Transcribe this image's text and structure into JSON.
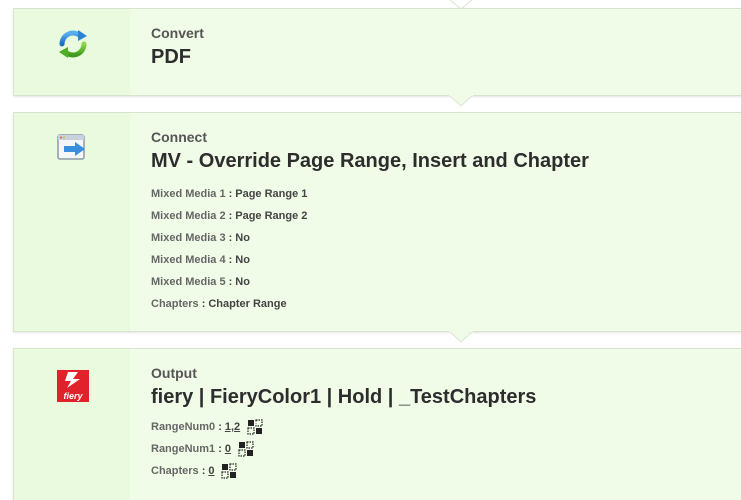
{
  "steps": [
    {
      "icon": "refresh-arrows-icon",
      "label": "Convert",
      "value": "PDF"
    },
    {
      "icon": "window-arrow-icon",
      "label": "Connect",
      "value": "MV - Override Page Range, Insert and Chapter",
      "properties": [
        {
          "key": "Mixed Media 1",
          "value": "Page Range 1"
        },
        {
          "key": "Mixed Media 2",
          "value": "Page Range 2"
        },
        {
          "key": "Mixed Media 3",
          "value": "No"
        },
        {
          "key": "Mixed Media 4",
          "value": "No"
        },
        {
          "key": "Mixed Media 5",
          "value": "No"
        },
        {
          "key": "Chapters",
          "value": "Chapter Range"
        }
      ]
    },
    {
      "icon": "fiery-logo-icon",
      "logo_text": "fiery",
      "label": "Output",
      "value": "fiery | FieryColor1 | Hold | _TestChapters",
      "properties": [
        {
          "key": "RangeNum0",
          "value": "1,2",
          "icon": "variable-icon"
        },
        {
          "key": "RangeNum1",
          "value": "0",
          "icon": "variable-icon"
        },
        {
          "key": "Chapters",
          "value": "0",
          "icon": "variable-icon"
        }
      ]
    }
  ],
  "separator": ":",
  "colors": {
    "card_bg": "#f1fce8",
    "card_gutter": "#eafadf",
    "fiery_red": "#e2222b"
  }
}
